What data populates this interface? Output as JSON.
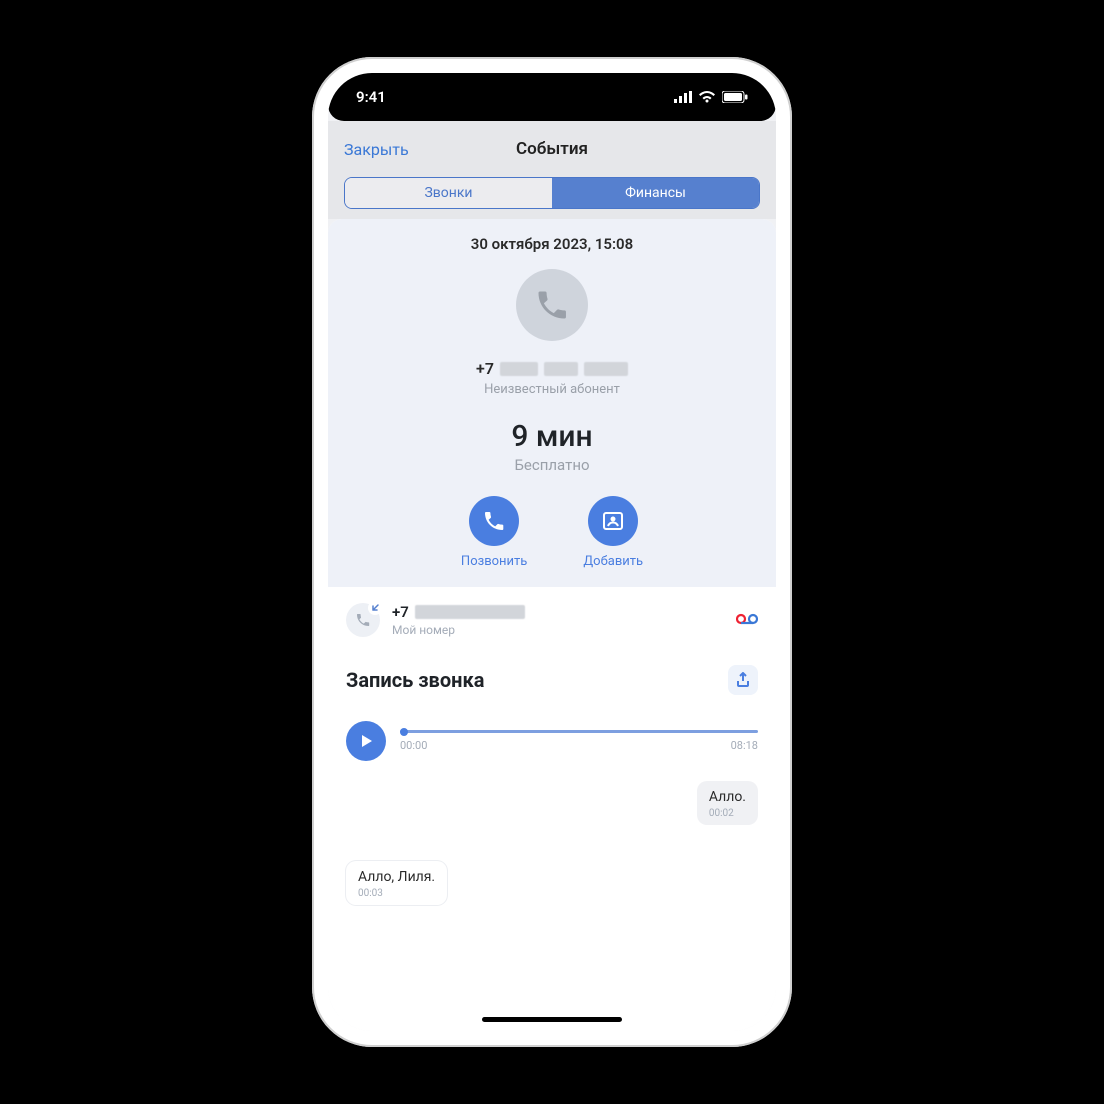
{
  "status": {
    "time": "9:41"
  },
  "header": {
    "close": "Закрыть",
    "title": "События"
  },
  "tabs": {
    "calls": "Звонки",
    "finance": "Финансы"
  },
  "call": {
    "date": "30 октября 2023, 15:08",
    "number_prefix": "+7",
    "caller_label": "Неизвестный абонент",
    "duration": "9 мин",
    "free": "Бесплатно"
  },
  "actions": {
    "call": "Позвонить",
    "add": "Добавить"
  },
  "my_number": {
    "prefix": "+7",
    "label": "Мой номер"
  },
  "recording": {
    "title": "Запись звонка",
    "start": "00:00",
    "end": "08:18"
  },
  "transcript": [
    {
      "side": "right",
      "text": "Алло.",
      "ts": "00:02"
    },
    {
      "side": "left",
      "text": "Алло, Лиля.",
      "ts": "00:03"
    }
  ]
}
